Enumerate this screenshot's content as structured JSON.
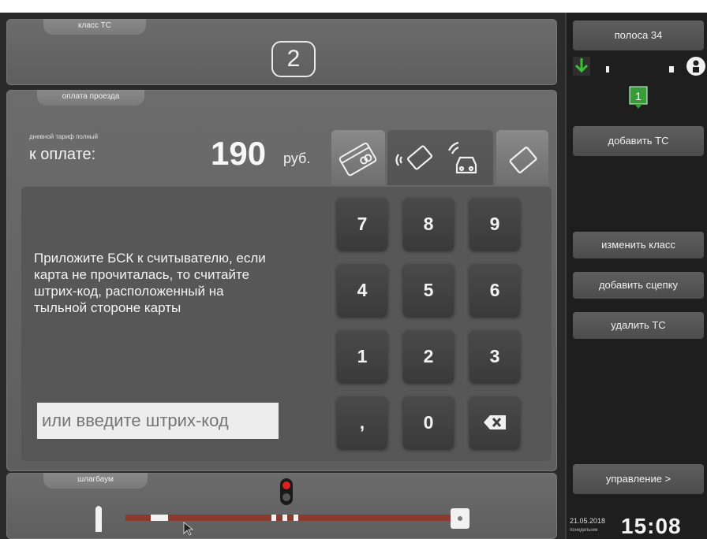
{
  "vehicle_class": {
    "label": "класс ТС",
    "value": "2"
  },
  "payment": {
    "label": "оплата проезда",
    "tariff": "дневной тариф полный",
    "to_pay_label": "к оплате:",
    "amount": "190",
    "currency": "руб.",
    "methods": [
      "bank-card-icon",
      "contactless-bsk-icon",
      "wallet-card-icon"
    ]
  },
  "instruction": "Приложите БСК к считывателю, если карта не прочиталась, то считайте штрих-код, расположенный на тыльной стороне карты",
  "barcode_placeholder": "или введите штрих-код",
  "keypad": [
    "7",
    "8",
    "9",
    "4",
    "5",
    "6",
    "1",
    "2",
    "3",
    ",",
    "0",
    "backspace-icon"
  ],
  "barrier": {
    "label": "шлагбаум",
    "light": "red"
  },
  "sidebar": {
    "lane": "полоса 34",
    "queue_count": "1",
    "add_vehicle": "добавить ТС",
    "change_class": "изменить класс",
    "add_trailer": "добавить сцепку",
    "delete_vehicle": "удалить ТС",
    "control": "управление >"
  },
  "datetime": {
    "date": "21.05.2018",
    "weekday": "понедельник",
    "time": "15:08"
  },
  "colors": {
    "accent_green": "#3a9a3a",
    "barrier_bar": "#8a3a2e",
    "signal_red": "#e02020"
  }
}
